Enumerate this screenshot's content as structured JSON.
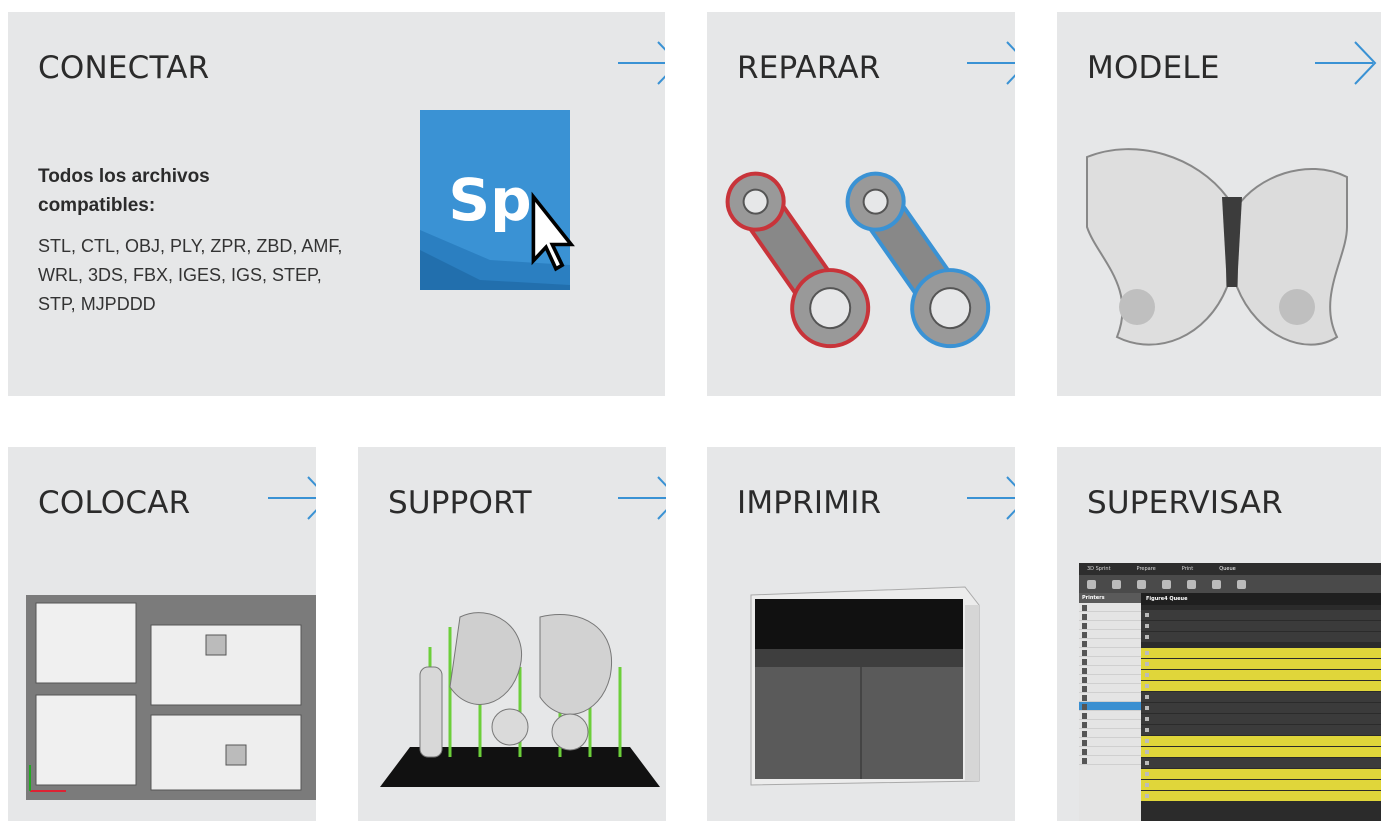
{
  "steps": {
    "connect": {
      "title": "CONECTAR",
      "files_heading": "Todos los archivos compatibles:",
      "files_list": "STL, CTL, OBJ, PLY, ZPR, ZBD, AMF, WRL, 3DS, FBX, IGES, IGS, STEP, STP, MJPDDD",
      "logo_text": "Sp"
    },
    "repair": {
      "title": "REPARAR"
    },
    "model": {
      "title": "MODELE"
    },
    "place": {
      "title": "COLOCAR"
    },
    "support": {
      "title": "SUPPORT"
    },
    "print": {
      "title": "IMPRIMIR"
    },
    "monitor": {
      "title": "SUPERVISAR",
      "mini_tabs": [
        "3D Sprint",
        "Prepare",
        "Print",
        "Queue"
      ],
      "mini_sidebar_title": "Printers",
      "mini_queue_title": "Figure4 Queue"
    }
  },
  "colors": {
    "card_bg": "#e6e7e8",
    "arrow": "#3a92d4",
    "logo_blue": "#3a92d4",
    "repair_red": "#c8343a",
    "repair_blue": "#3a92d4",
    "support_green": "#6ccf3a",
    "queue_yellow": "#e0d63a"
  },
  "icons": {
    "arrow": "chevron-arrow-right-icon",
    "cursor": "mouse-pointer-icon"
  }
}
